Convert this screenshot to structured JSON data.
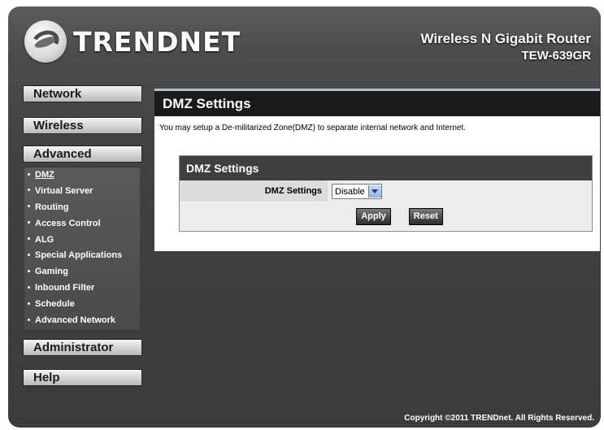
{
  "header": {
    "brand": "TRENDNET",
    "product_name": "Wireless N Gigabit Router",
    "model": "TEW-639GR"
  },
  "nav": {
    "network": "Network",
    "wireless": "Wireless",
    "advanced": "Advanced",
    "administrator": "Administrator",
    "help": "Help",
    "advanced_items": [
      "DMZ",
      "Virtual Server",
      "Routing",
      "Access Control",
      "ALG",
      "Special Applications",
      "Gaming",
      "Inbound Filter",
      "Schedule",
      "Advanced Network"
    ],
    "active_item": "DMZ"
  },
  "main": {
    "title": "DMZ Settings",
    "description": "You may setup a De-militarized Zone(DMZ) to separate internal network and Internet.",
    "section_title": "DMZ Settings",
    "field_label": "DMZ Settings",
    "field_value": "Disable",
    "apply_label": "Apply",
    "reset_label": "Reset"
  },
  "footer": {
    "copyright": "Copyright ©2011 TRENDnet. All Rights Reserved."
  },
  "colors": {
    "title_bar": "#1a1a1a",
    "title_accent": "#9ec3e6",
    "frame": "#404040"
  }
}
